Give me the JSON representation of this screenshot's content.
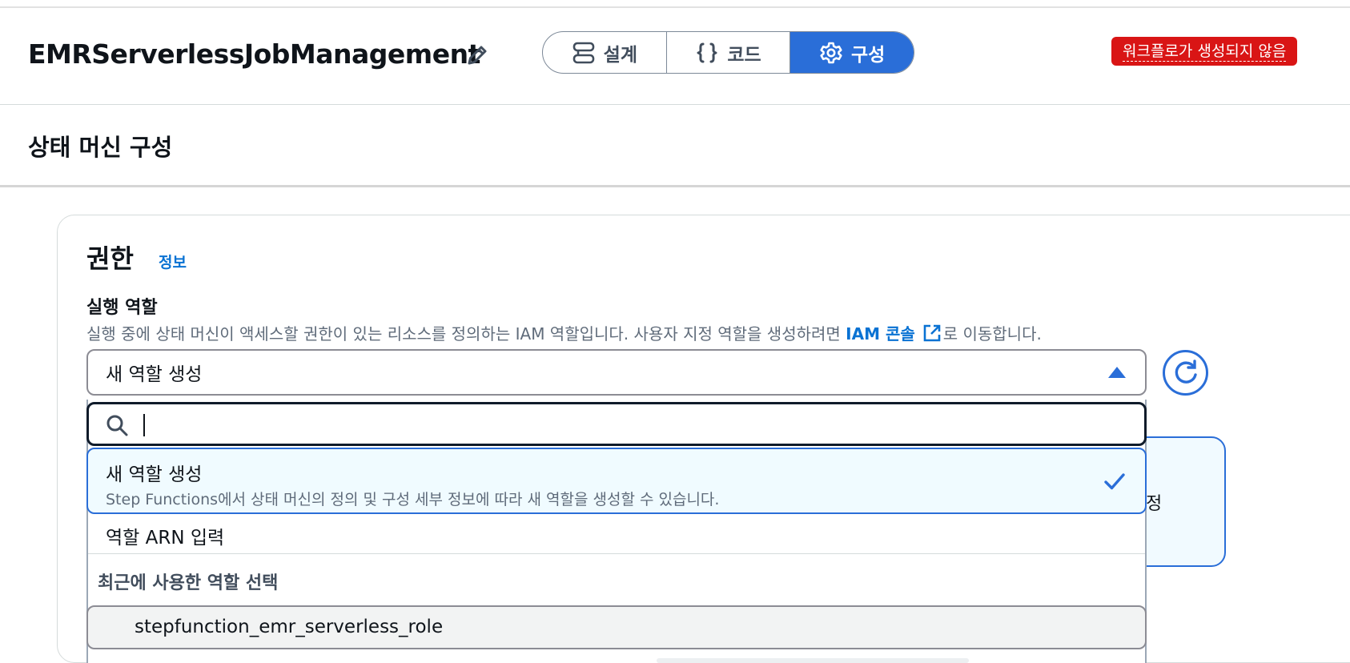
{
  "header": {
    "title": "EMRServerlessJobManagement",
    "tabs": [
      {
        "label": "설계",
        "icon": "design-icon",
        "active": false
      },
      {
        "label": "코드",
        "icon": "code-braces-icon",
        "active": false
      },
      {
        "label": "구성",
        "icon": "gear-icon",
        "active": true
      }
    ],
    "status_badge": "워크플로가 생성되지 않음"
  },
  "section": {
    "title": "상태 머신 구성"
  },
  "permissions": {
    "title": "권한",
    "info_link": "정보",
    "execution_role_label": "실행 역할",
    "description_prefix": "실행 중에 상태 머신이 액세스할 권한이 있는 리소스를 정의하는 IAM 역할입니다. 사용자 지정 역할을 생성하려면 ",
    "description_link": "IAM 콘솔",
    "description_suffix": "로 이동합니다.",
    "selected_value": "새 역할 생성",
    "background_panel_text": "정"
  },
  "dropdown": {
    "search_value": "",
    "options": [
      {
        "label": "새 역할 생성",
        "description": "Step Functions에서 상태 머신의 정의 및 구성 세부 정보에 따라 새 역할을 생성할 수 있습니다.",
        "selected": true
      },
      {
        "label": "역할 ARN 입력"
      }
    ],
    "group_label": "최근에 사용한 역할 선택",
    "recent_roles": [
      "stepfunction_emr_serverless_role"
    ]
  },
  "colors": {
    "accent": "#2a6ed8",
    "link": "#0972d3",
    "error_badge": "#d91515",
    "selected_bg": "#f0fbff"
  }
}
